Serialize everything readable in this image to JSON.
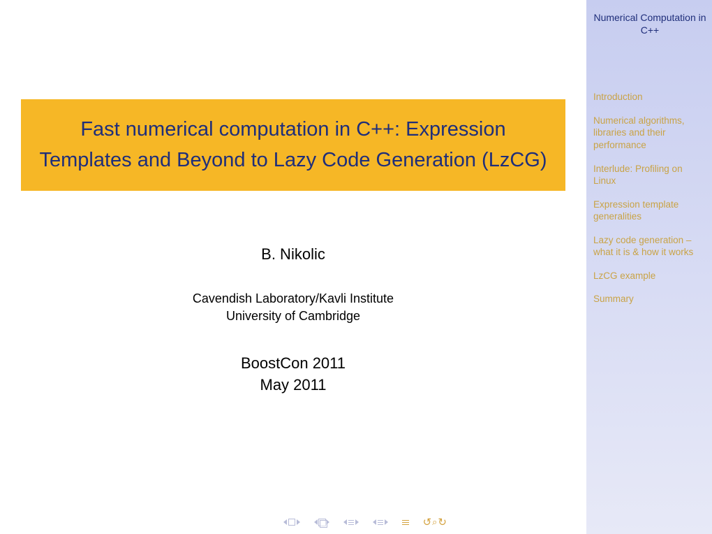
{
  "title": "Fast numerical computation in C++: Expression Templates and Beyond to Lazy Code Generation (LzCG)",
  "author": "B. Nikolic",
  "affiliation_line1": "Cavendish Laboratory/Kavli Institute",
  "affiliation_line2": "University of Cambridge",
  "event_line1": "BoostCon 2011",
  "event_line2": "May 2011",
  "sidebar": {
    "title": "Numerical Computation in C++",
    "items": [
      "Introduction",
      "Numerical algorithms, libraries and their performance",
      "Interlude: Profiling on Linux",
      "Expression template generalities",
      "Lazy code generation – what it is & how it works",
      "LzCG example",
      "Summary"
    ]
  }
}
